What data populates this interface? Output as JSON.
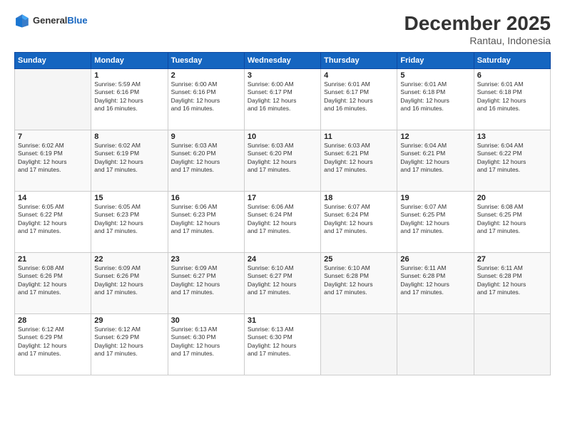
{
  "header": {
    "logo": {
      "line1": "General",
      "line2": "Blue"
    },
    "title": "December 2025",
    "location": "Rantau, Indonesia"
  },
  "weekdays": [
    "Sunday",
    "Monday",
    "Tuesday",
    "Wednesday",
    "Thursday",
    "Friday",
    "Saturday"
  ],
  "weeks": [
    [
      {
        "day": "",
        "content": ""
      },
      {
        "day": "1",
        "content": "Sunrise: 5:59 AM\nSunset: 6:16 PM\nDaylight: 12 hours\nand 16 minutes."
      },
      {
        "day": "2",
        "content": "Sunrise: 6:00 AM\nSunset: 6:16 PM\nDaylight: 12 hours\nand 16 minutes."
      },
      {
        "day": "3",
        "content": "Sunrise: 6:00 AM\nSunset: 6:17 PM\nDaylight: 12 hours\nand 16 minutes."
      },
      {
        "day": "4",
        "content": "Sunrise: 6:01 AM\nSunset: 6:17 PM\nDaylight: 12 hours\nand 16 minutes."
      },
      {
        "day": "5",
        "content": "Sunrise: 6:01 AM\nSunset: 6:18 PM\nDaylight: 12 hours\nand 16 minutes."
      },
      {
        "day": "6",
        "content": "Sunrise: 6:01 AM\nSunset: 6:18 PM\nDaylight: 12 hours\nand 16 minutes."
      }
    ],
    [
      {
        "day": "7",
        "content": "Sunrise: 6:02 AM\nSunset: 6:19 PM\nDaylight: 12 hours\nand 17 minutes."
      },
      {
        "day": "8",
        "content": "Sunrise: 6:02 AM\nSunset: 6:19 PM\nDaylight: 12 hours\nand 17 minutes."
      },
      {
        "day": "9",
        "content": "Sunrise: 6:03 AM\nSunset: 6:20 PM\nDaylight: 12 hours\nand 17 minutes."
      },
      {
        "day": "10",
        "content": "Sunrise: 6:03 AM\nSunset: 6:20 PM\nDaylight: 12 hours\nand 17 minutes."
      },
      {
        "day": "11",
        "content": "Sunrise: 6:03 AM\nSunset: 6:21 PM\nDaylight: 12 hours\nand 17 minutes."
      },
      {
        "day": "12",
        "content": "Sunrise: 6:04 AM\nSunset: 6:21 PM\nDaylight: 12 hours\nand 17 minutes."
      },
      {
        "day": "13",
        "content": "Sunrise: 6:04 AM\nSunset: 6:22 PM\nDaylight: 12 hours\nand 17 minutes."
      }
    ],
    [
      {
        "day": "14",
        "content": "Sunrise: 6:05 AM\nSunset: 6:22 PM\nDaylight: 12 hours\nand 17 minutes."
      },
      {
        "day": "15",
        "content": "Sunrise: 6:05 AM\nSunset: 6:23 PM\nDaylight: 12 hours\nand 17 minutes."
      },
      {
        "day": "16",
        "content": "Sunrise: 6:06 AM\nSunset: 6:23 PM\nDaylight: 12 hours\nand 17 minutes."
      },
      {
        "day": "17",
        "content": "Sunrise: 6:06 AM\nSunset: 6:24 PM\nDaylight: 12 hours\nand 17 minutes."
      },
      {
        "day": "18",
        "content": "Sunrise: 6:07 AM\nSunset: 6:24 PM\nDaylight: 12 hours\nand 17 minutes."
      },
      {
        "day": "19",
        "content": "Sunrise: 6:07 AM\nSunset: 6:25 PM\nDaylight: 12 hours\nand 17 minutes."
      },
      {
        "day": "20",
        "content": "Sunrise: 6:08 AM\nSunset: 6:25 PM\nDaylight: 12 hours\nand 17 minutes."
      }
    ],
    [
      {
        "day": "21",
        "content": "Sunrise: 6:08 AM\nSunset: 6:26 PM\nDaylight: 12 hours\nand 17 minutes."
      },
      {
        "day": "22",
        "content": "Sunrise: 6:09 AM\nSunset: 6:26 PM\nDaylight: 12 hours\nand 17 minutes."
      },
      {
        "day": "23",
        "content": "Sunrise: 6:09 AM\nSunset: 6:27 PM\nDaylight: 12 hours\nand 17 minutes."
      },
      {
        "day": "24",
        "content": "Sunrise: 6:10 AM\nSunset: 6:27 PM\nDaylight: 12 hours\nand 17 minutes."
      },
      {
        "day": "25",
        "content": "Sunrise: 6:10 AM\nSunset: 6:28 PM\nDaylight: 12 hours\nand 17 minutes."
      },
      {
        "day": "26",
        "content": "Sunrise: 6:11 AM\nSunset: 6:28 PM\nDaylight: 12 hours\nand 17 minutes."
      },
      {
        "day": "27",
        "content": "Sunrise: 6:11 AM\nSunset: 6:28 PM\nDaylight: 12 hours\nand 17 minutes."
      }
    ],
    [
      {
        "day": "28",
        "content": "Sunrise: 6:12 AM\nSunset: 6:29 PM\nDaylight: 12 hours\nand 17 minutes."
      },
      {
        "day": "29",
        "content": "Sunrise: 6:12 AM\nSunset: 6:29 PM\nDaylight: 12 hours\nand 17 minutes."
      },
      {
        "day": "30",
        "content": "Sunrise: 6:13 AM\nSunset: 6:30 PM\nDaylight: 12 hours\nand 17 minutes."
      },
      {
        "day": "31",
        "content": "Sunrise: 6:13 AM\nSunset: 6:30 PM\nDaylight: 12 hours\nand 17 minutes."
      },
      {
        "day": "",
        "content": ""
      },
      {
        "day": "",
        "content": ""
      },
      {
        "day": "",
        "content": ""
      }
    ]
  ]
}
